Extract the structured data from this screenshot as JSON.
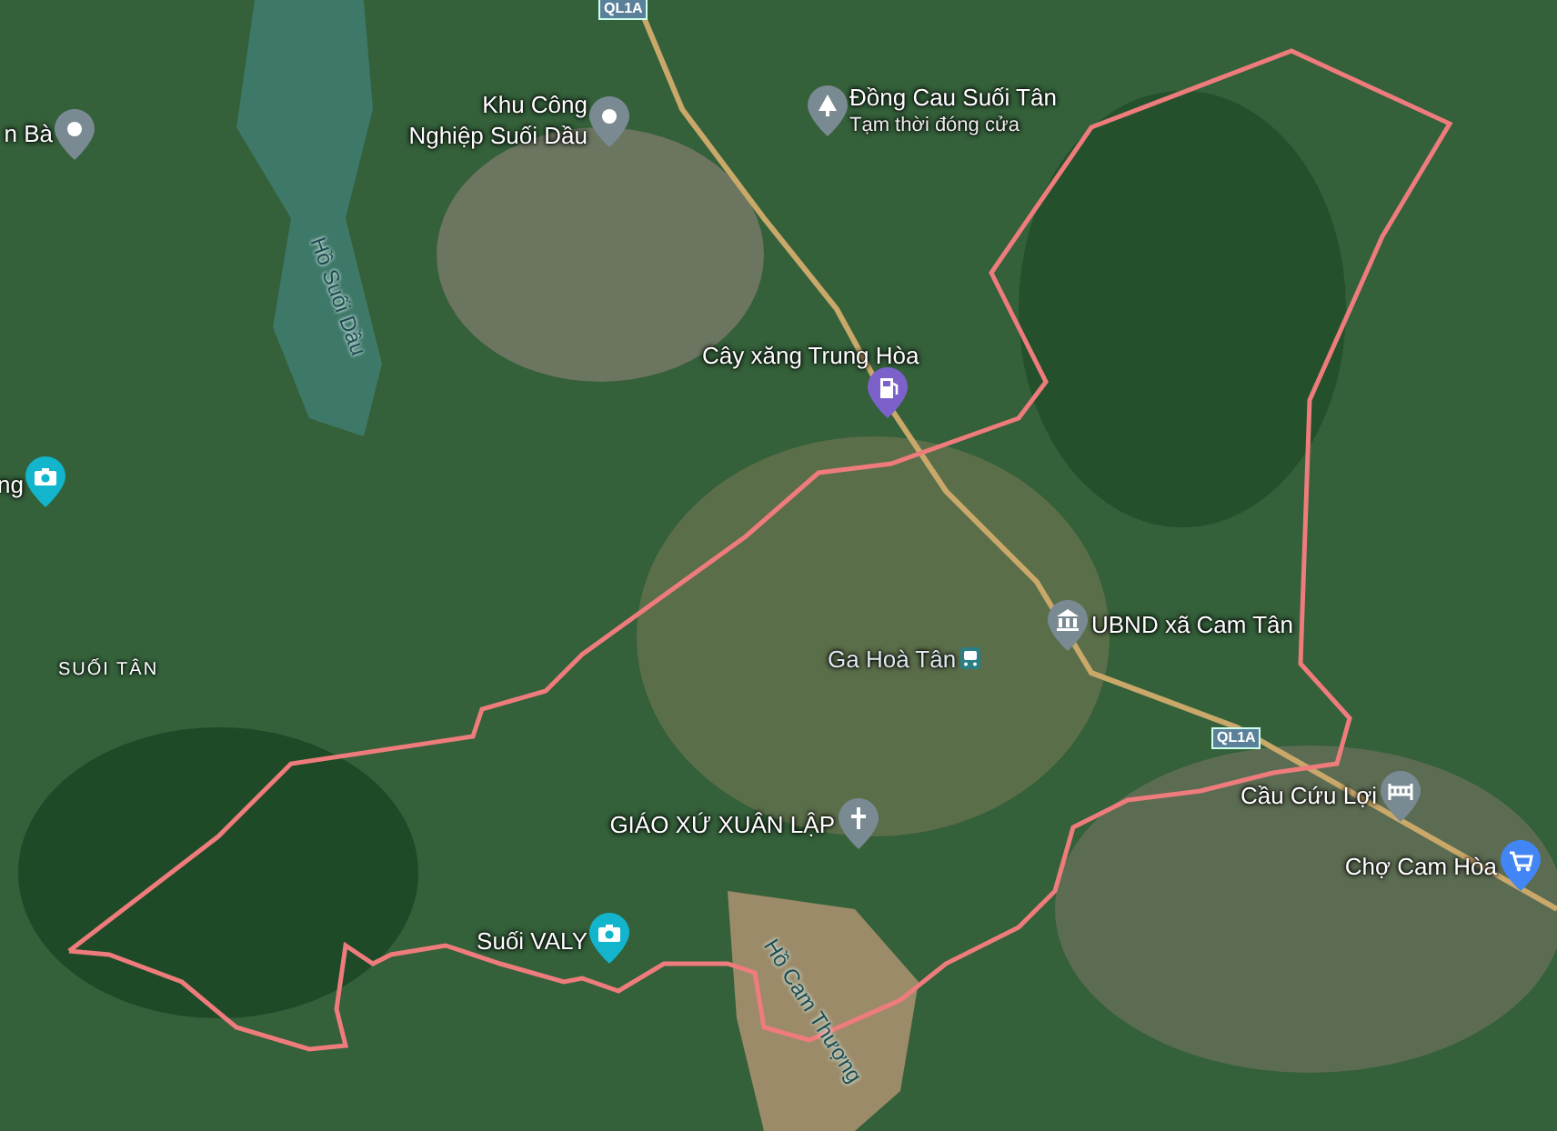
{
  "map": {
    "road_shields": [
      {
        "label": "QL1A"
      },
      {
        "label": "QL1A"
      }
    ],
    "places": [
      {
        "kind": "generic",
        "label": "n Bà"
      },
      {
        "kind": "generic",
        "label": "Khu Công\nNghiệp Suối Dầu"
      },
      {
        "kind": "park",
        "label": "Đồng Cau Suối Tân",
        "subtitle": "Tạm thời đóng cửa"
      },
      {
        "kind": "fuel",
        "label": "Cây xăng Trung Hòa"
      },
      {
        "kind": "camera",
        "label": "ng"
      },
      {
        "kind": "government",
        "label": "UBND xã Cam Tân"
      },
      {
        "kind": "train",
        "label": "Ga Hoà Tân"
      },
      {
        "kind": "church",
        "label": "GIÁO XỨ XUÂN LẬP"
      },
      {
        "kind": "camera",
        "label": "Suối VALY"
      },
      {
        "kind": "bridge",
        "label": "Cầu Cứu Lợi"
      },
      {
        "kind": "shop",
        "label": "Chợ Cam Hòa"
      }
    ],
    "water_labels": [
      {
        "label": "Hồ Suối Dầu"
      },
      {
        "label": "Hồ Cam Thượng"
      }
    ],
    "area_labels": [
      {
        "label": "SUỐI TÂN"
      }
    ]
  }
}
